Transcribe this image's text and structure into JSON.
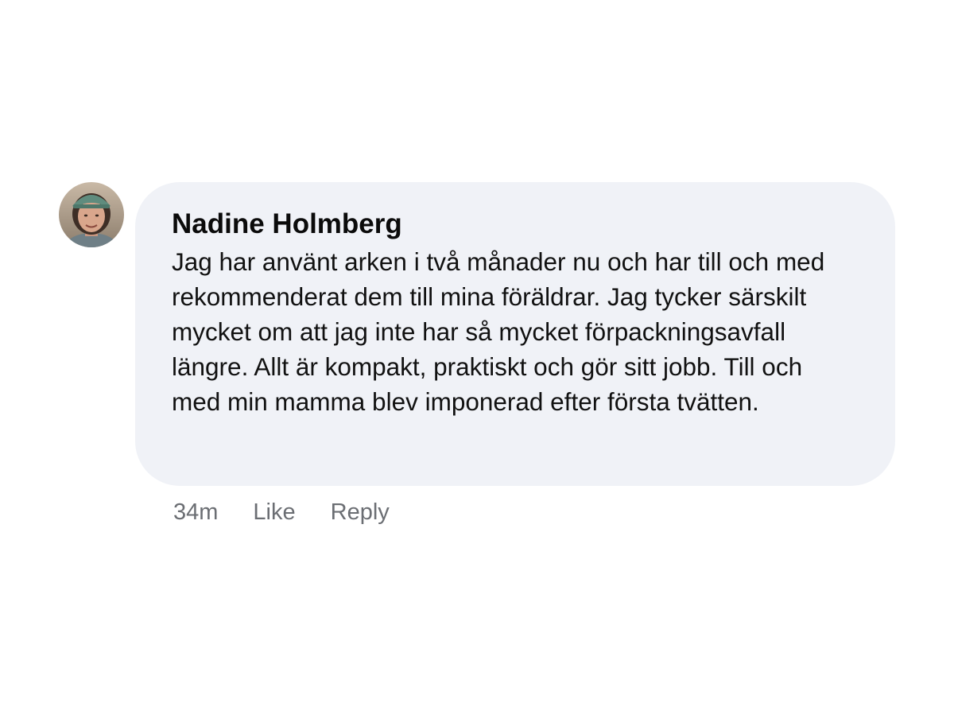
{
  "comment": {
    "author": "Nadine Holmberg",
    "avatar_icon": "user-photo-avatar",
    "text": "Jag har använt arken i två månader nu och har till och med rekommenderat dem till mina föräldrar. Jag tycker särskilt mycket om att jag inte har så mycket förpackningsavfall längre. Allt är kompakt, praktiskt och gör sitt jobb. Till och med min mamma blev imponerad efter första tvätten.",
    "timestamp": "34m",
    "like_label": "Like",
    "reply_label": "Reply"
  },
  "colors": {
    "bubble_background": "#f0f2f7",
    "author_text": "#0b0b0b",
    "body_text": "#111111",
    "action_text": "#6b6e73"
  }
}
